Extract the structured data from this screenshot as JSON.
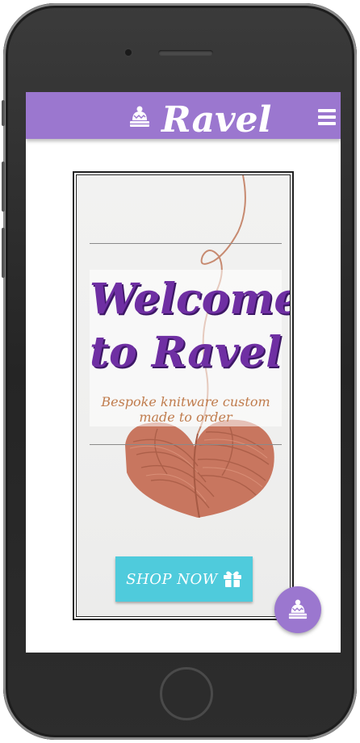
{
  "header": {
    "brand": "Ravel",
    "logo_icon": "beanie-hat-icon",
    "menu_icon": "hamburger-menu-icon"
  },
  "hero": {
    "welcome_line1": "Welcome",
    "welcome_line2": "to Ravel",
    "tagline": "Bespoke knitware custom made to order",
    "shop_button": "SHOP NOW",
    "shop_icon": "gift-icon",
    "background_image": "yarn-heart-image"
  },
  "fab": {
    "icon": "beanie-hat-icon"
  },
  "colors": {
    "brand_purple": "#9b77cf",
    "heading_purple": "#6f2fa3",
    "tagline_tan": "#c07c4d",
    "button_cyan": "#4fcbdc"
  }
}
